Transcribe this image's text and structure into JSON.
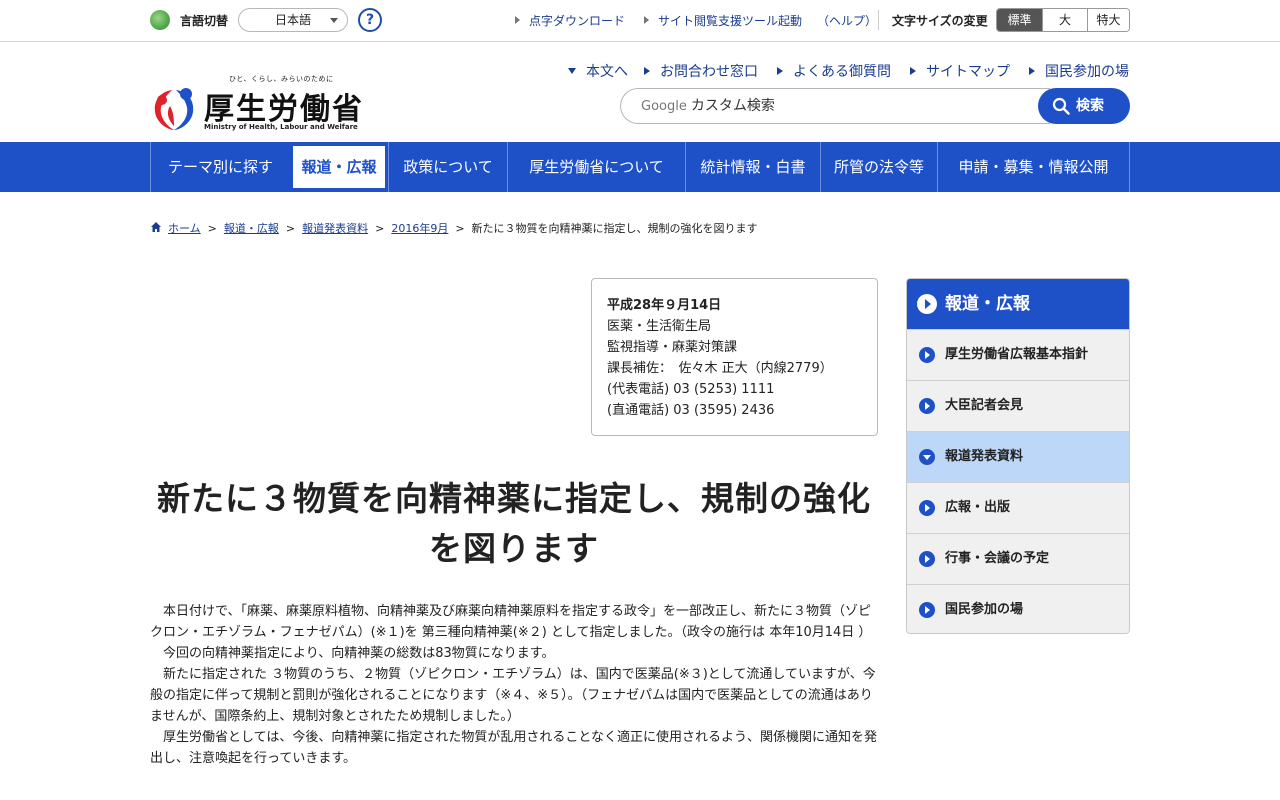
{
  "topbar": {
    "lang_label": "言語切替",
    "lang_value": "日本語",
    "help": "?",
    "links": [
      "点字ダウンロード",
      "サイト閲覧支援ツール起動"
    ],
    "help_link": "（ヘルプ）",
    "fontsize_label": "文字サイズの変更",
    "fontsize_options": [
      "標準",
      "大",
      "特大"
    ],
    "fontsize_selected": "標準"
  },
  "header": {
    "logo_tagline": "ひと、くらし、みらいのために",
    "logo_name": "厚生労働省",
    "logo_en": "Ministry of Health, Labour and Welfare",
    "links": [
      "本文へ",
      "お問合わせ窓口",
      "よくある御質問",
      "サイトマップ",
      "国民参加の場"
    ],
    "search_brand": "Google",
    "search_placeholder": "カスタム検索",
    "search_button": "検索"
  },
  "gnav": {
    "items": [
      "テーマ別に探す",
      "報道・広報",
      "政策について",
      "厚生労働省について",
      "統計情報・白書",
      "所管の法令等",
      "申請・募集・情報公開"
    ],
    "active": "報道・広報"
  },
  "breadcrumb": {
    "items": [
      "ホーム",
      "報道・広報",
      "報道発表資料",
      "2016年9月"
    ],
    "current": "新たに３物質を向精神薬に指定し、規制の強化を図ります"
  },
  "contact": {
    "date": "平成28年９月14日",
    "lines": [
      "医薬・生活衛生局",
      "監視指導・麻薬対策課",
      "課長補佐：　佐々木 正大（内線2779）",
      "(代表電話) 03 (5253) 1111",
      "(直通電話) 03 (3595) 2436"
    ]
  },
  "article": {
    "title": "新たに３物質を向精神薬に指定し、規制の強化を図ります",
    "paragraphs": [
      "本日付けで、「麻薬、麻薬原料植物、向精神薬及び麻薬向精神薬原料を指定する政令」を一部改正し、新たに３物質（ゾピクロン・エチゾラム・フェナゼパム）(※１)を 第三種向精神薬(※２) として指定しました。（政令の施行は 本年10月14日 ）",
      "今回の向精神薬指定により、向精神薬の総数は83物質になります。",
      "新たに指定された ３物質のうち、２物質（ゾピクロン・エチゾラム）は、国内で医薬品(※３)として流通していますが、今般の指定に伴って規制と罰則が強化されることになります（※４、※５）。（フェナゼパムは国内で医薬品としての流通はありませんが、国際条約上、規制対象とされたため規制しました。）",
      "厚生労働省としては、今後、向精神薬に指定された物質が乱用されることなく適正に使用されるよう、関係機関に通知を発出し、注意喚起を行っていきます。"
    ]
  },
  "sidenav": {
    "heading": "報道・広報",
    "items": [
      "厚生労働省広報基本指針",
      "大臣記者会見",
      "報道発表資料",
      "広報・出版",
      "行事・会議の予定",
      "国民参加の場"
    ],
    "active": "報道発表資料"
  }
}
